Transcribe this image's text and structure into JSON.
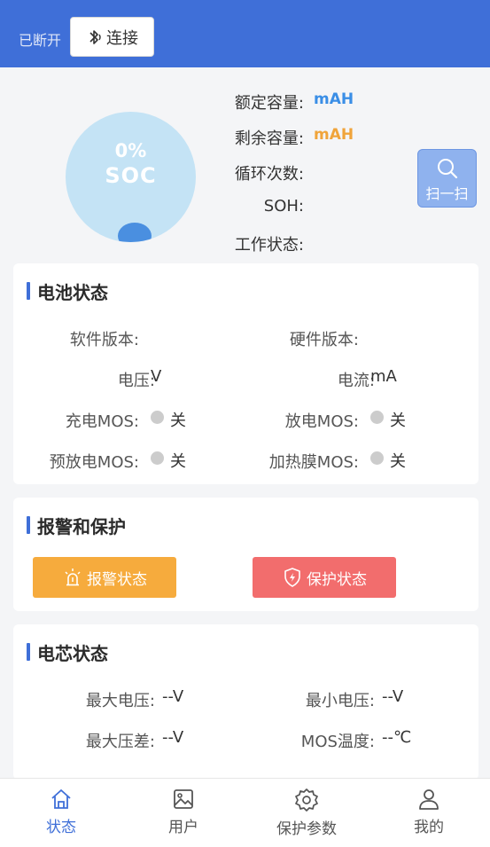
{
  "header": {
    "connection_status": "已断开",
    "connect_label": "连接"
  },
  "summary": {
    "soc_percent": "0%",
    "soc_label": "SOC",
    "rated_capacity_label": "额定容量:",
    "rated_capacity_value": "mAH",
    "remaining_capacity_label": "剩余容量:",
    "remaining_capacity_value": "mAH",
    "cycle_count_label": "循环次数:",
    "soh_label": "SOH:",
    "work_status_label": "工作状态:",
    "scan_label": "扫一扫",
    "colors": {
      "rated": "#3a8ee6",
      "remaining": "#f0a43a"
    }
  },
  "battery_status": {
    "title": "电池状态",
    "software_version_label": "软件版本:",
    "hardware_version_label": "硬件版本:",
    "voltage_label": "电压:",
    "voltage_value": "V",
    "current_label": "电流:",
    "current_value": "mA",
    "charge_mos_label": "充电MOS:",
    "charge_mos_value": "关",
    "discharge_mos_label": "放电MOS:",
    "discharge_mos_value": "关",
    "predischarge_mos_label": "预放电MOS:",
    "predischarge_mos_value": "关",
    "heater_mos_label": "加热膜MOS:",
    "heater_mos_value": "关"
  },
  "alarm_protect": {
    "title": "报警和保护",
    "alarm_label": "报警状态",
    "protect_label": "保护状态",
    "colors": {
      "alarm": "#f6ab3d",
      "protect": "#f26d6d"
    }
  },
  "cell_status": {
    "title": "电芯状态",
    "max_voltage_label": "最大电压:",
    "max_voltage_value": "--V",
    "min_voltage_label": "最小电压:",
    "min_voltage_value": "--V",
    "max_diff_label": "最大压差:",
    "max_diff_value": "--V",
    "mos_temp_label": "MOS温度:",
    "mos_temp_value": "--℃"
  },
  "tabbar": {
    "items": [
      {
        "label": "状态",
        "icon": "home-icon",
        "active": true
      },
      {
        "label": "用户",
        "icon": "image-icon",
        "active": false
      },
      {
        "label": "保护参数",
        "icon": "gear-icon",
        "active": false
      },
      {
        "label": "我的",
        "icon": "person-icon",
        "active": false
      }
    ],
    "active_color": "#3f6fd8"
  }
}
